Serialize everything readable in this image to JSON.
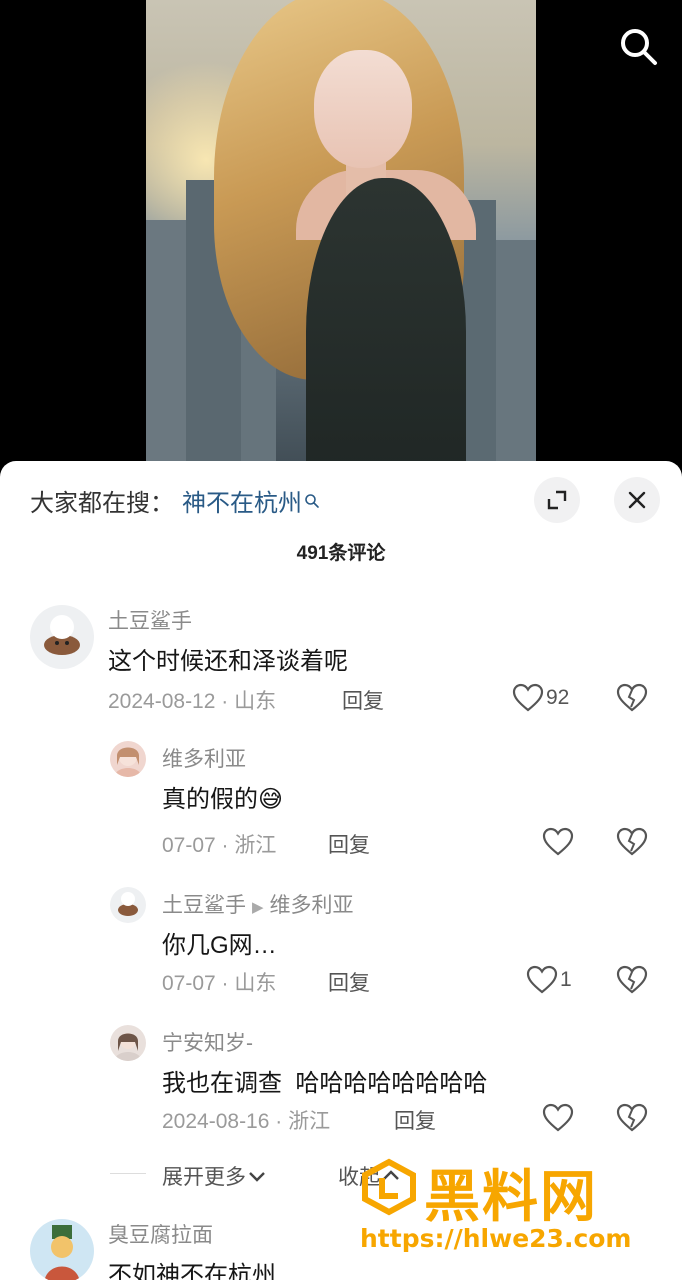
{
  "trending": {
    "prefix": "大家都在搜：",
    "keyword": "神不在杭州"
  },
  "comment_count": "491条评论",
  "comments": [
    {
      "user": "土豆鲨手",
      "text": "这个时候还和泽谈着呢",
      "date": "2024-08-12",
      "location": "山东",
      "reply": "回复",
      "likes": "92"
    },
    {
      "user": "维多利亚",
      "text": "真的假的",
      "emoji": "😅",
      "date": "07-07",
      "location": "浙江",
      "reply": "回复",
      "likes": ""
    },
    {
      "user": "土豆鲨手",
      "reply_to": "维多利亚",
      "text": "你几G网…",
      "date": "07-07",
      "location": "山东",
      "reply": "回复",
      "likes": "1"
    },
    {
      "user": "宁安知岁-",
      "text": "我也在调查  哈哈哈哈哈哈哈哈",
      "date": "2024-08-16",
      "location": "浙江",
      "reply": "回复",
      "likes": ""
    },
    {
      "user": "臭豆腐拉面",
      "text": "不如神不在杭州"
    }
  ],
  "expand_label": "展开更多",
  "collapse_label": "收起",
  "watermark": {
    "title": "黑料网",
    "url": "https://hlwe23.com"
  },
  "colors": {
    "link": "#295a86",
    "watermark": "#f7a600",
    "meta": "#9a9a9a"
  }
}
